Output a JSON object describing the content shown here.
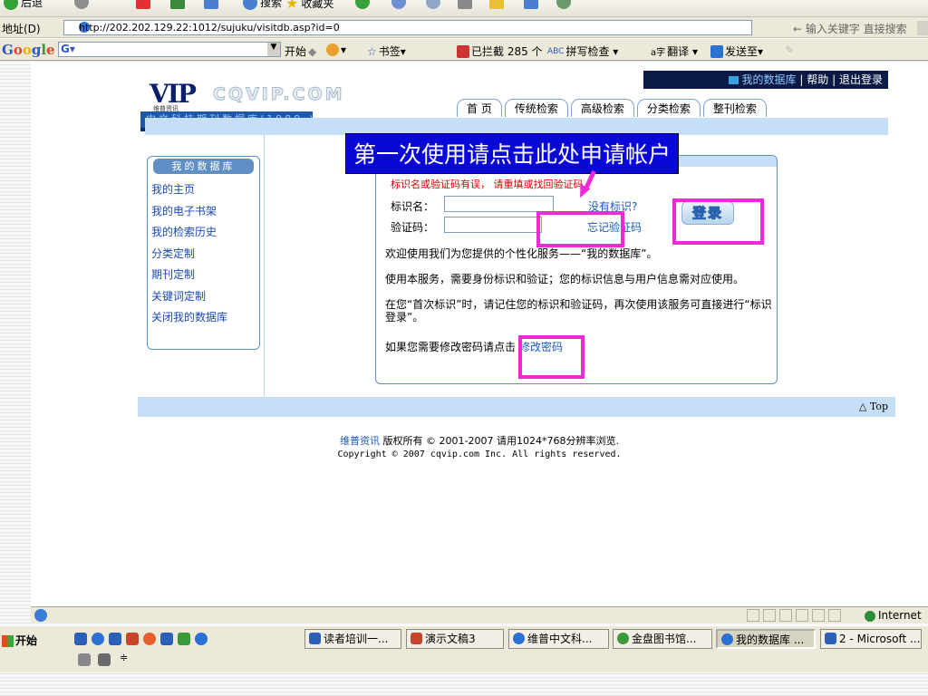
{
  "browser": {
    "toolbar": {
      "back_label": "后退",
      "search_label": "搜索",
      "favorites_label": "收藏夹"
    },
    "address": {
      "label": "地址(D)",
      "url": "http://202.202.129.22:1012/sujuku/visitdb.asp?id=0",
      "search_hint": "← 输入关键字 直接搜索"
    },
    "googlebar": {
      "logo": "Google",
      "field_prefix": "G▾",
      "start_label": "开始",
      "bookmarks_label": "书签▾",
      "blocked_label": "已拦截 285 个",
      "spellcheck_label": "拼写检查 ▾",
      "translate_label": "翻译 ▾",
      "sendto_label": "发送至▾"
    }
  },
  "site": {
    "logo": {
      "vip": "VIP",
      "vip_sub": "维普资讯",
      "cqvip": "CQVIP.COM",
      "tagline": "中文科技期刊数据库(1989-)"
    },
    "top_links": {
      "mydb": "我的数据库",
      "help": "帮助",
      "logout": "退出登录",
      "sep": "|"
    },
    "nav_tabs": [
      "首 页",
      "传统检索",
      "高级检索",
      "分类检索",
      "整刊检索"
    ],
    "sidebar": {
      "title": "我的数据库",
      "items": [
        "我的主页",
        "我的电子书架",
        "我的检索历史",
        "分类定制",
        "期刊定制",
        "关键词定制",
        "关闭我的数据库"
      ]
    },
    "login": {
      "error": "标识名或验证码有误， 请重填或找回验证码",
      "id_label": "标识名：",
      "code_label": "验证码：",
      "no_id_link": "没有标识?",
      "forgot_link": "忘记验证码",
      "login_button": "登录",
      "p1": "欢迎使用我们为您提供的个性化服务——“我的数据库”。",
      "p2": "使用本服务，需要身份标识和验证；您的标识信息与用户信息需对应使用。",
      "p3": "在您“首次标识”时，请记住您的标识和验证码，再次使用该服务可直接进行“标识登录”。",
      "p4_prefix": "如果您需要修改密码请点击",
      "change_pw_link": "修改密码"
    },
    "callout": "第一次使用请点击此处申请帐户",
    "top_link": "△ Top",
    "copyright_line1_brand": "维普资讯",
    "copyright_line1_rest": " 版权所有 © 2001-2007 请用1024*768分辨率浏览.",
    "copyright_line2": "Copyright © 2007 cqvip.com Inc. All rights reserved."
  },
  "status": {
    "zone": "Internet"
  },
  "taskbar": {
    "start": "开始",
    "tasks": [
      {
        "label": "读者培训一...",
        "color": "#2b5fb8"
      },
      {
        "label": "演示文稿3",
        "color": "#c8442a"
      },
      {
        "label": "维普中文科...",
        "color": "#2b70d3"
      },
      {
        "label": "金盘图书馆...",
        "color": "#3a9a3a"
      },
      {
        "label": "我的数据库 ...",
        "color": "#2b70d3"
      },
      {
        "label": "2 - Microsoft ...",
        "color": "#2b5fb8"
      }
    ]
  }
}
